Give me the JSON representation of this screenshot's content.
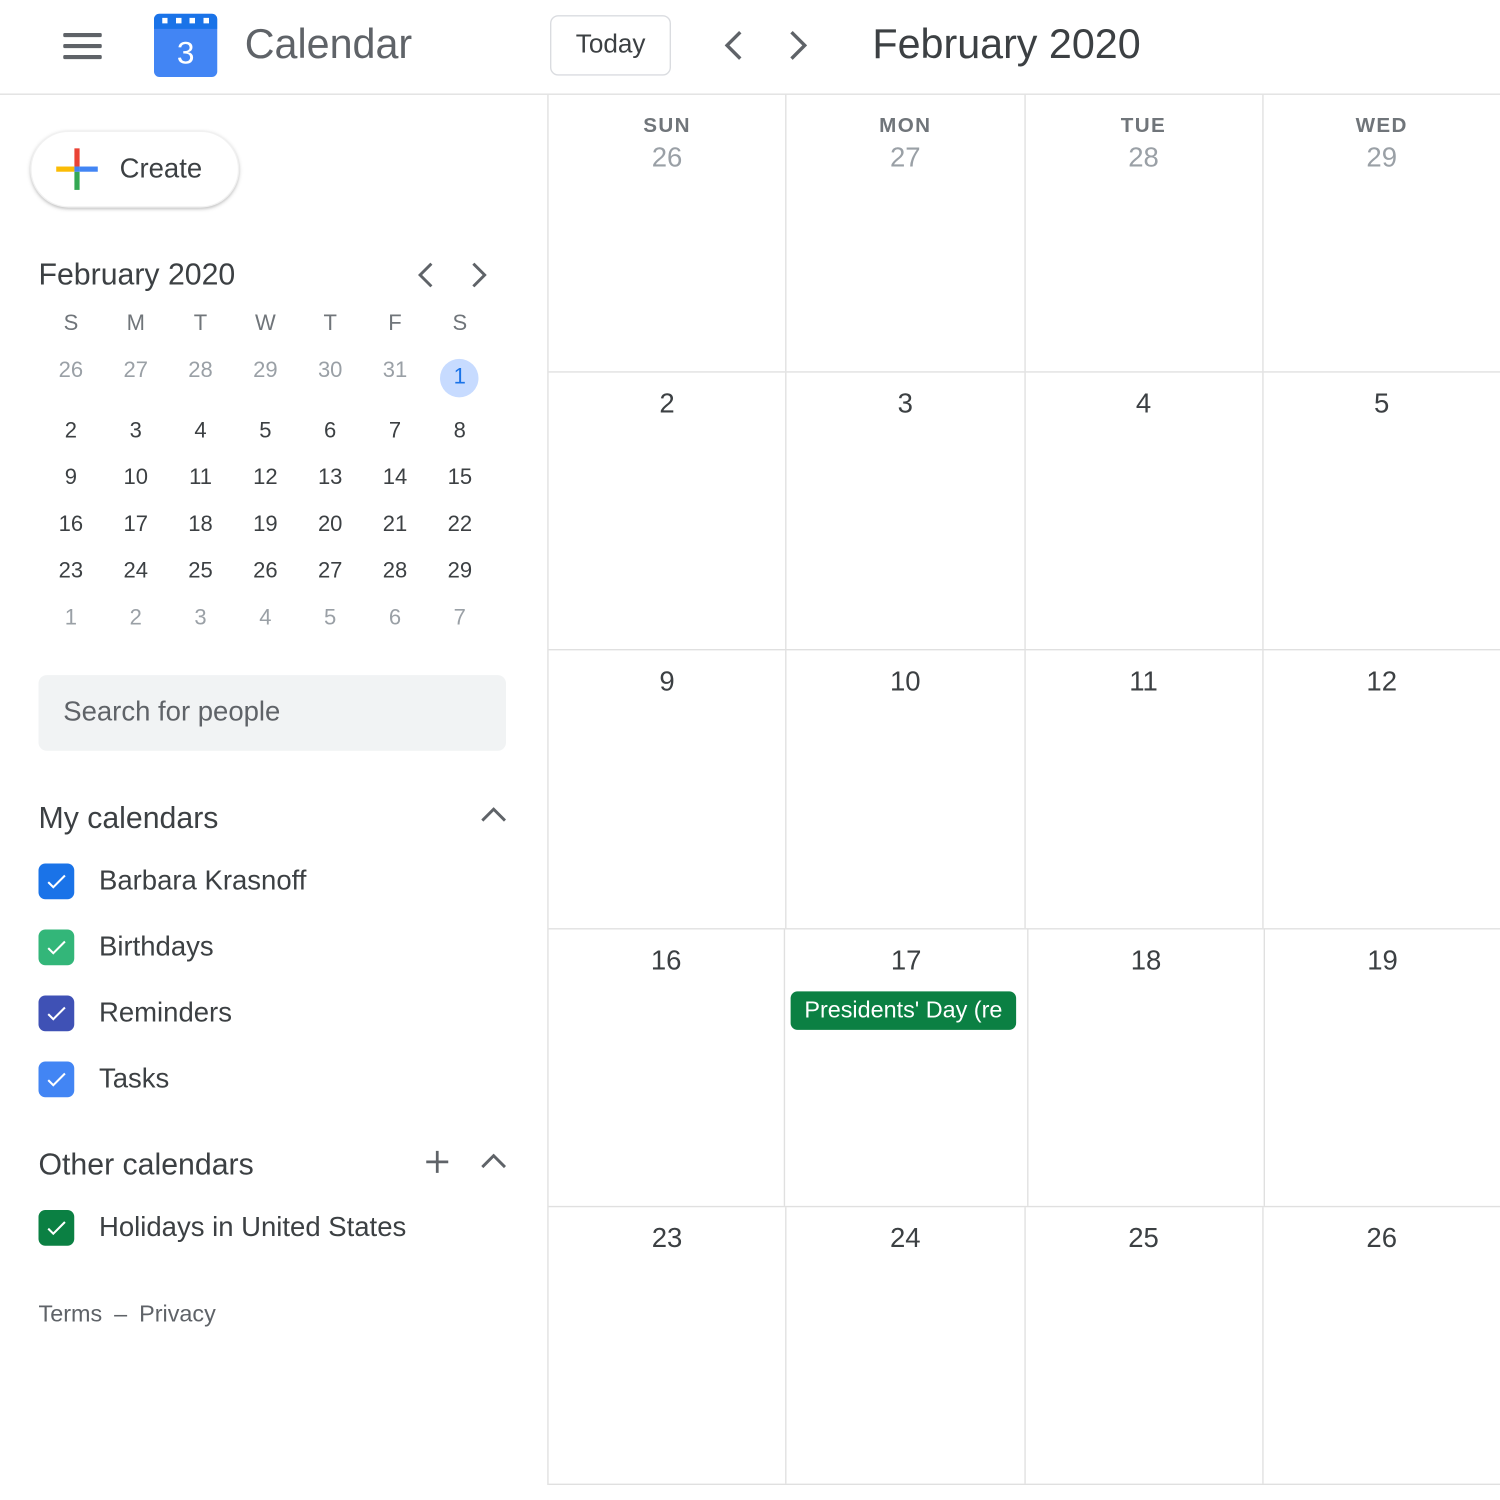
{
  "header": {
    "logo_day": "3",
    "app_title": "Calendar",
    "today_label": "Today",
    "month_title": "February 2020"
  },
  "sidebar": {
    "create_label": "Create",
    "mini_cal": {
      "title": "February 2020",
      "dow": [
        "S",
        "M",
        "T",
        "W",
        "T",
        "F",
        "S"
      ],
      "days": [
        {
          "n": "26",
          "muted": true
        },
        {
          "n": "27",
          "muted": true
        },
        {
          "n": "28",
          "muted": true
        },
        {
          "n": "29",
          "muted": true
        },
        {
          "n": "30",
          "muted": true
        },
        {
          "n": "31",
          "muted": true
        },
        {
          "n": "1",
          "sel": true
        },
        {
          "n": "2"
        },
        {
          "n": "3"
        },
        {
          "n": "4"
        },
        {
          "n": "5"
        },
        {
          "n": "6"
        },
        {
          "n": "7"
        },
        {
          "n": "8"
        },
        {
          "n": "9"
        },
        {
          "n": "10"
        },
        {
          "n": "11"
        },
        {
          "n": "12"
        },
        {
          "n": "13"
        },
        {
          "n": "14"
        },
        {
          "n": "15"
        },
        {
          "n": "16"
        },
        {
          "n": "17"
        },
        {
          "n": "18"
        },
        {
          "n": "19"
        },
        {
          "n": "20"
        },
        {
          "n": "21"
        },
        {
          "n": "22"
        },
        {
          "n": "23"
        },
        {
          "n": "24"
        },
        {
          "n": "25"
        },
        {
          "n": "26"
        },
        {
          "n": "27"
        },
        {
          "n": "28"
        },
        {
          "n": "29"
        },
        {
          "n": "1",
          "muted": true
        },
        {
          "n": "2",
          "muted": true
        },
        {
          "n": "3",
          "muted": true
        },
        {
          "n": "4",
          "muted": true
        },
        {
          "n": "5",
          "muted": true
        },
        {
          "n": "6",
          "muted": true
        },
        {
          "n": "7",
          "muted": true
        }
      ]
    },
    "search_placeholder": "Search for people",
    "my_calendars_title": "My calendars",
    "my_calendars": [
      {
        "label": "Barbara Krasnoff",
        "color": "#1a73e8"
      },
      {
        "label": "Birthdays",
        "color": "#33b679"
      },
      {
        "label": "Reminders",
        "color": "#3f51b5"
      },
      {
        "label": "Tasks",
        "color": "#4285f4"
      }
    ],
    "other_calendars_title": "Other calendars",
    "other_calendars": [
      {
        "label": "Holidays in United States",
        "color": "#0b8043"
      }
    ],
    "terms": "Terms",
    "dash": "–",
    "privacy": "Privacy"
  },
  "main": {
    "dow": [
      "SUN",
      "MON",
      "TUE",
      "WED"
    ],
    "weeks": [
      [
        {
          "n": "26",
          "muted": true
        },
        {
          "n": "27",
          "muted": true
        },
        {
          "n": "28",
          "muted": true
        },
        {
          "n": "29",
          "muted": true
        }
      ],
      [
        {
          "n": "2"
        },
        {
          "n": "3"
        },
        {
          "n": "4"
        },
        {
          "n": "5"
        }
      ],
      [
        {
          "n": "9"
        },
        {
          "n": "10"
        },
        {
          "n": "11"
        },
        {
          "n": "12"
        }
      ],
      [
        {
          "n": "16"
        },
        {
          "n": "17",
          "event": "Presidents' Day (re"
        },
        {
          "n": "18"
        },
        {
          "n": "19"
        }
      ],
      [
        {
          "n": "23"
        },
        {
          "n": "24"
        },
        {
          "n": "25"
        },
        {
          "n": "26"
        }
      ]
    ]
  }
}
